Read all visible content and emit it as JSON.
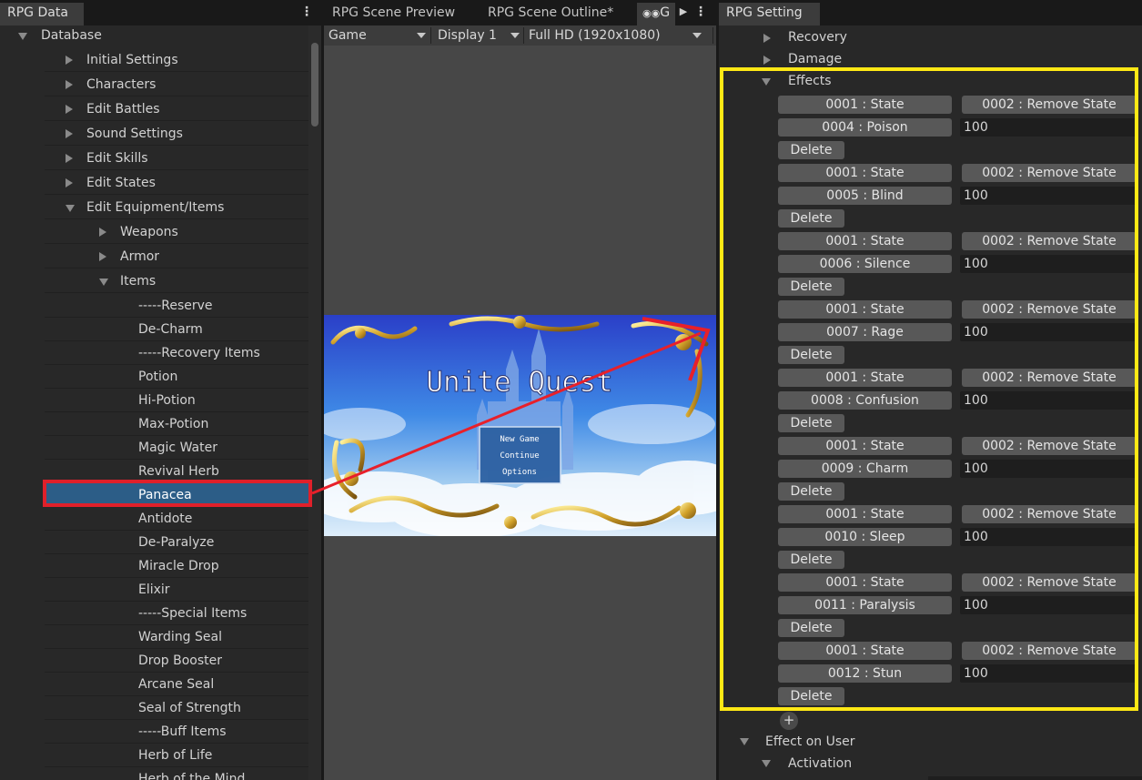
{
  "left_panel": {
    "tab": "RPG Data",
    "items": [
      {
        "label": "Database",
        "indent": 0,
        "exp": "d"
      },
      {
        "label": "Initial Settings",
        "indent": 1,
        "exp": "r"
      },
      {
        "label": "Characters",
        "indent": 1,
        "exp": "r"
      },
      {
        "label": "Edit Battles",
        "indent": 1,
        "exp": "r"
      },
      {
        "label": "Sound Settings",
        "indent": 1,
        "exp": "r"
      },
      {
        "label": "Edit Skills",
        "indent": 1,
        "exp": "r"
      },
      {
        "label": "Edit States",
        "indent": 1,
        "exp": "r"
      },
      {
        "label": "Edit Equipment/Items",
        "indent": 1,
        "exp": "d"
      },
      {
        "label": "Weapons",
        "indent": 2,
        "exp": "r"
      },
      {
        "label": "Armor",
        "indent": 2,
        "exp": "r"
      },
      {
        "label": "Items",
        "indent": 2,
        "exp": "d"
      },
      {
        "label": "-----Reserve",
        "indent": 3
      },
      {
        "label": "De-Charm",
        "indent": 3
      },
      {
        "label": "-----Recovery Items",
        "indent": 3
      },
      {
        "label": "Potion",
        "indent": 3
      },
      {
        "label": "Hi-Potion",
        "indent": 3
      },
      {
        "label": "Max-Potion",
        "indent": 3
      },
      {
        "label": "Magic Water",
        "indent": 3
      },
      {
        "label": "Revival Herb",
        "indent": 3
      },
      {
        "label": "Panacea",
        "indent": 3,
        "selected": true
      },
      {
        "label": "Antidote",
        "indent": 3
      },
      {
        "label": "De-Paralyze",
        "indent": 3
      },
      {
        "label": "Miracle Drop",
        "indent": 3
      },
      {
        "label": "Elixir",
        "indent": 3
      },
      {
        "label": "-----Special Items",
        "indent": 3
      },
      {
        "label": "Warding Seal",
        "indent": 3
      },
      {
        "label": "Drop Booster",
        "indent": 3
      },
      {
        "label": "Arcane Seal",
        "indent": 3
      },
      {
        "label": "Seal of Strength",
        "indent": 3
      },
      {
        "label": "-----Buff Items",
        "indent": 3
      },
      {
        "label": "Herb of Life",
        "indent": 3
      },
      {
        "label": "Herb of the Mind",
        "indent": 3
      }
    ]
  },
  "middle_panel": {
    "tabs": [
      "RPG Scene Preview",
      "RPG Scene Outline*",
      "G"
    ],
    "toolbar": {
      "game": "Game",
      "display": "Display 1",
      "resolution": "Full HD (1920x1080)"
    },
    "game": {
      "title": "Unite Quest",
      "menu": [
        "New Game",
        "Continue",
        "Options"
      ]
    }
  },
  "right_panel": {
    "tab": "RPG Setting",
    "sections": {
      "recovery": "Recovery",
      "damage": "Damage",
      "effects": "Effects",
      "effect_on_user": "Effect on User",
      "activation": "Activation"
    },
    "effects": [
      {
        "type": "0001 : State",
        "action": "0002 : Remove State",
        "target": "0004 : Poison",
        "value": "100",
        "delete": "Delete"
      },
      {
        "type": "0001 : State",
        "action": "0002 : Remove State",
        "target": "0005 : Blind",
        "value": "100",
        "delete": "Delete"
      },
      {
        "type": "0001 : State",
        "action": "0002 : Remove State",
        "target": "0006 : Silence",
        "value": "100",
        "delete": "Delete"
      },
      {
        "type": "0001 : State",
        "action": "0002 : Remove State",
        "target": "0007 : Rage",
        "value": "100",
        "delete": "Delete"
      },
      {
        "type": "0001 : State",
        "action": "0002 : Remove State",
        "target": "0008 : Confusion",
        "value": "100",
        "delete": "Delete"
      },
      {
        "type": "0001 : State",
        "action": "0002 : Remove State",
        "target": "0009 : Charm",
        "value": "100",
        "delete": "Delete"
      },
      {
        "type": "0001 : State",
        "action": "0002 : Remove State",
        "target": "0010 : Sleep",
        "value": "100",
        "delete": "Delete"
      },
      {
        "type": "0001 : State",
        "action": "0002 : Remove State",
        "target": "0011 : Paralysis",
        "value": "100",
        "delete": "Delete"
      },
      {
        "type": "0001 : State",
        "action": "0002 : Remove State",
        "target": "0012 : Stun",
        "value": "100",
        "delete": "Delete"
      }
    ],
    "add_symbol": "+"
  },
  "colors": {
    "highlight_red": "#e0202a",
    "highlight_yellow": "#ffe815",
    "selection": "#2c5d87",
    "arrow": "#e8202a"
  }
}
